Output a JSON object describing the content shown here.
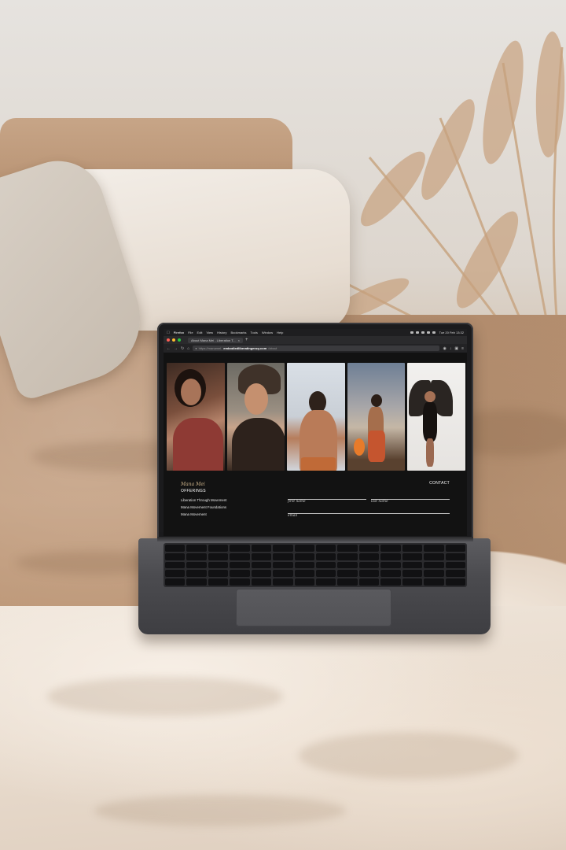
{
  "menu_bar": {
    "apple_icon": "apple-icon",
    "app_name": "Firefox",
    "items": [
      "File",
      "Edit",
      "View",
      "History",
      "Bookmarks",
      "Tools",
      "Window",
      "Help"
    ],
    "clock": "Tue 20 Feb 13:32"
  },
  "browser": {
    "tab_title": "About Mana Mei - Liberation T...",
    "url_prefix": "https://manamei.",
    "url_domain": "embodiedliberatingency.com",
    "url_path": "/about"
  },
  "page": {
    "gallery_photos": [
      {
        "name": "gallery-photo-1"
      },
      {
        "name": "gallery-photo-2"
      },
      {
        "name": "gallery-photo-3"
      },
      {
        "name": "gallery-photo-4"
      },
      {
        "name": "gallery-photo-5"
      }
    ],
    "logo_text": "Mana Mei",
    "offerings_heading": "OFFERINGS",
    "offerings": [
      "Liberation Through Movement",
      "Mana Movement Foundations",
      "Mana Movement"
    ],
    "contact_heading": "CONTACT",
    "form": {
      "first_name_label": "first name",
      "last_name_label": "last name",
      "email_label": "email"
    }
  }
}
